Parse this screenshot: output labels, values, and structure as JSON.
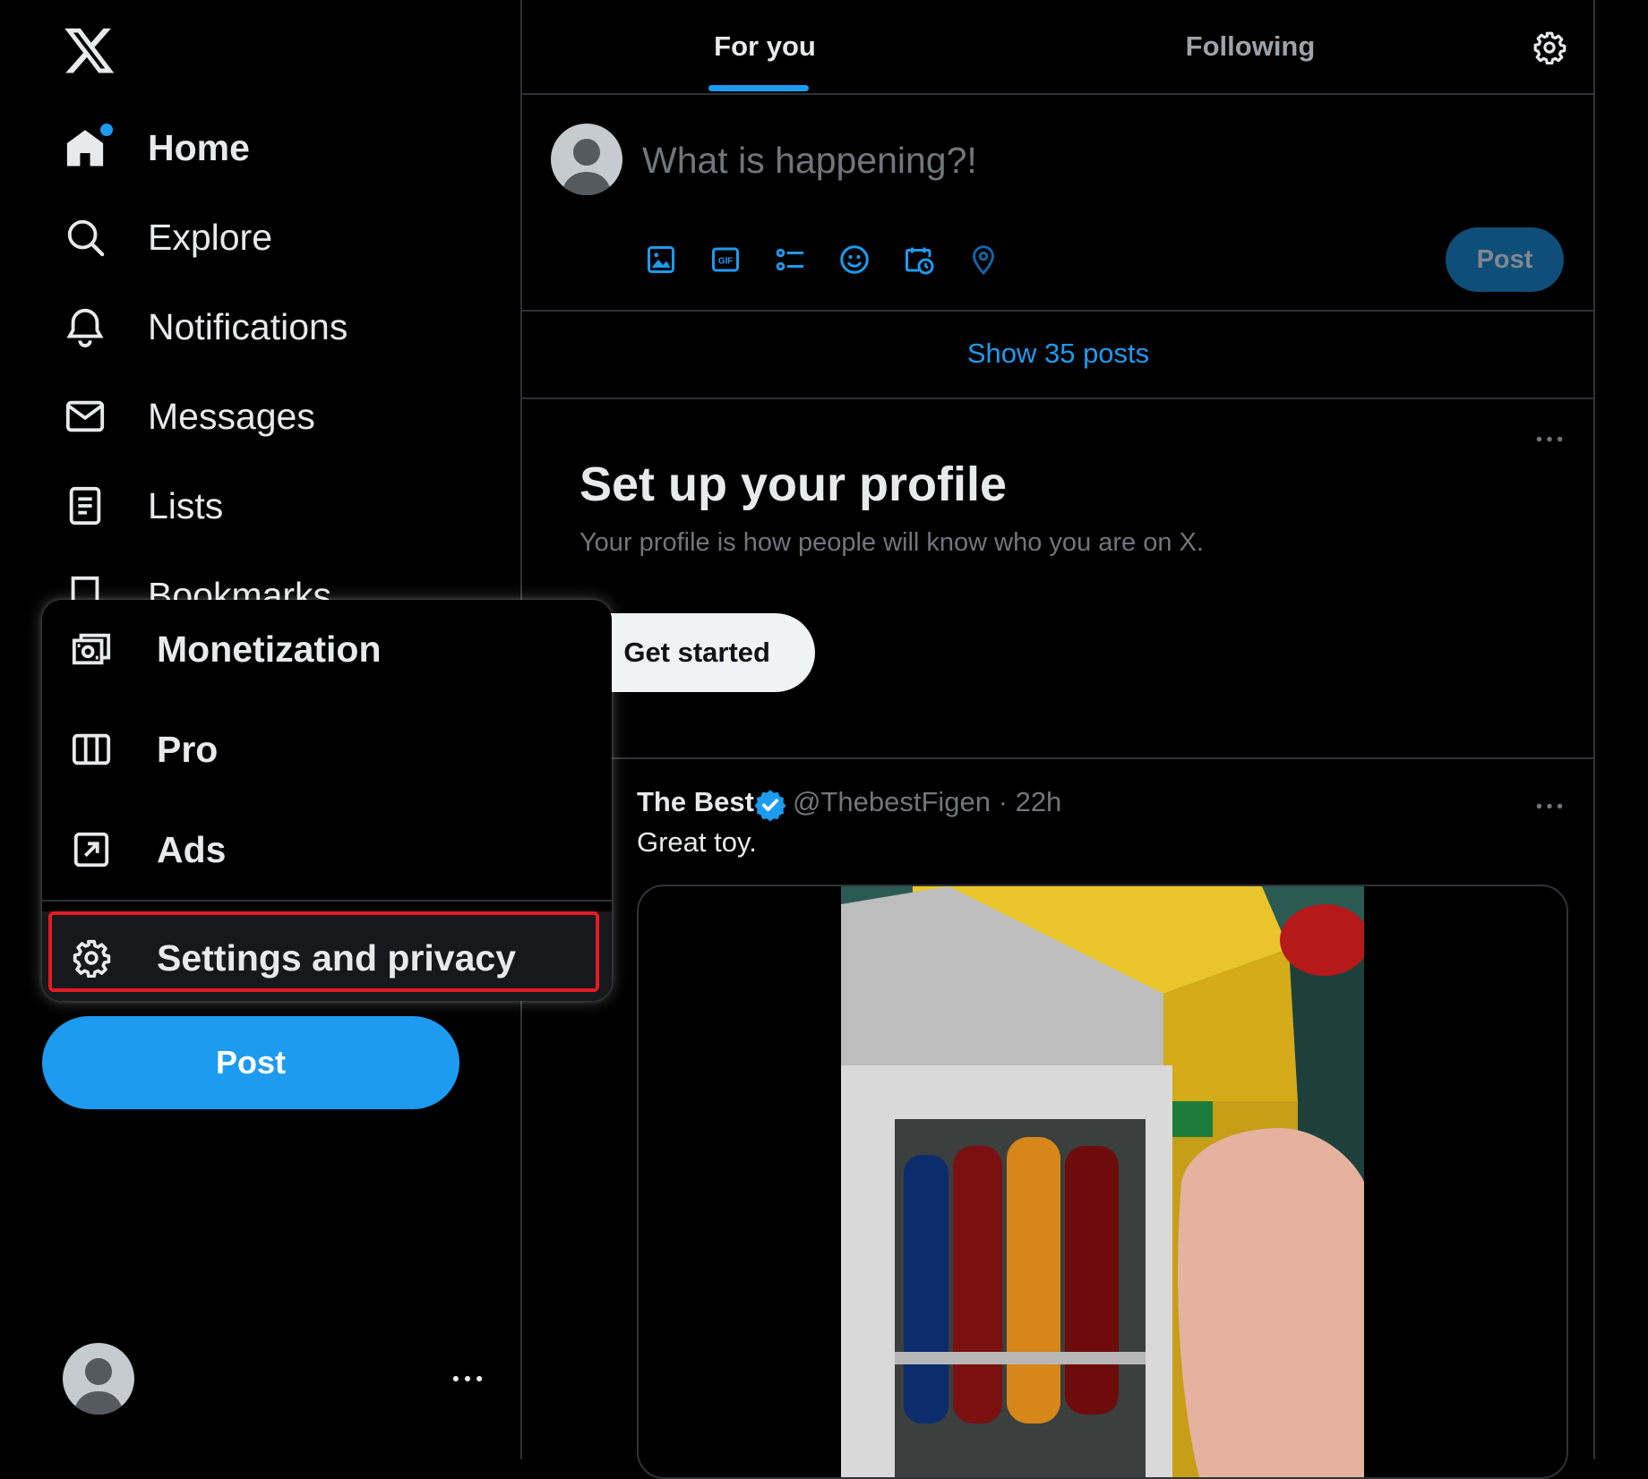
{
  "sidebar": {
    "logo": "x-logo-icon",
    "nav": [
      {
        "label": "Home",
        "icon": "home-icon",
        "active": true,
        "has_dot": true
      },
      {
        "label": "Explore",
        "icon": "search-icon"
      },
      {
        "label": "Notifications",
        "icon": "bell-icon"
      },
      {
        "label": "Messages",
        "icon": "mail-icon"
      },
      {
        "label": "Lists",
        "icon": "list-icon"
      },
      {
        "label": "Bookmarks",
        "icon": "bookmark-icon"
      }
    ],
    "post_label": "Post"
  },
  "menu": {
    "items": [
      {
        "label": "Monetization",
        "icon": "monetization-icon"
      },
      {
        "label": "Pro",
        "icon": "columns-icon"
      },
      {
        "label": "Ads",
        "icon": "ads-icon"
      },
      {
        "label": "Settings and privacy",
        "icon": "gear-icon",
        "highlighted": true
      }
    ]
  },
  "feed": {
    "tabs": [
      {
        "label": "For you",
        "active": true
      },
      {
        "label": "Following",
        "active": false
      }
    ],
    "composer": {
      "placeholder": "What is happening?!",
      "tools": [
        "image-icon",
        "gif-icon",
        "poll-icon",
        "emoji-icon",
        "schedule-icon",
        "location-icon"
      ],
      "post_label": "Post"
    },
    "show_posts": "Show 35 posts",
    "profile_card": {
      "title": "Set up your profile",
      "subtitle": "Your profile is how people will know who you are on X.",
      "button": "Get started"
    },
    "tweet": {
      "author": "The Best",
      "handle_time": "@ThebestFigen · 22h",
      "text": "Great toy."
    }
  },
  "colors": {
    "accent": "#1d9bf0",
    "highlight_border": "#e11b22",
    "background": "#000000",
    "divider": "#2f3336",
    "muted_text": "#71767b"
  }
}
